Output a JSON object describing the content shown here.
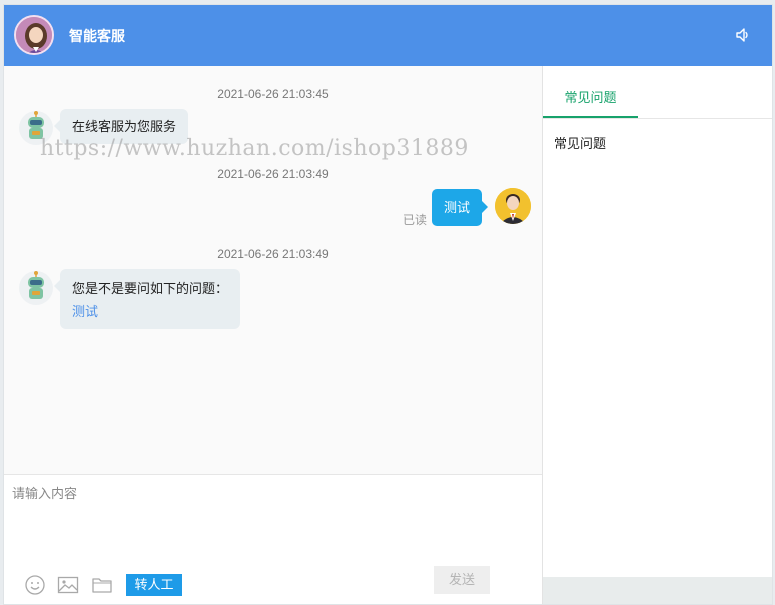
{
  "header": {
    "title": "智能客服",
    "volume_icon": "volume-icon"
  },
  "watermark": "https://www.huzhan.com/ishop31889",
  "messages": [
    {
      "time": "2021-06-26 21:03:45",
      "sender": "bot",
      "text": "在线客服为您服务"
    },
    {
      "time": "2021-06-26 21:03:49",
      "sender": "user",
      "text": "测试",
      "status": "已读"
    },
    {
      "time": "2021-06-26 21:03:49",
      "sender": "bot",
      "text": "您是不是要问如下的问题：",
      "link": "测试"
    }
  ],
  "composer": {
    "placeholder": "请输入内容",
    "value": "",
    "tools": [
      "emoji-icon",
      "image-icon",
      "folder-icon"
    ],
    "human_label": "转人工",
    "send_label": "发送"
  },
  "faq": {
    "tab_label": "常见问题",
    "items": [
      "常见问题"
    ]
  },
  "colors": {
    "header": "#4d90e8",
    "user_bubble": "#1da7e8",
    "accent_green": "#17a26b",
    "human_button": "#1e9be8"
  }
}
